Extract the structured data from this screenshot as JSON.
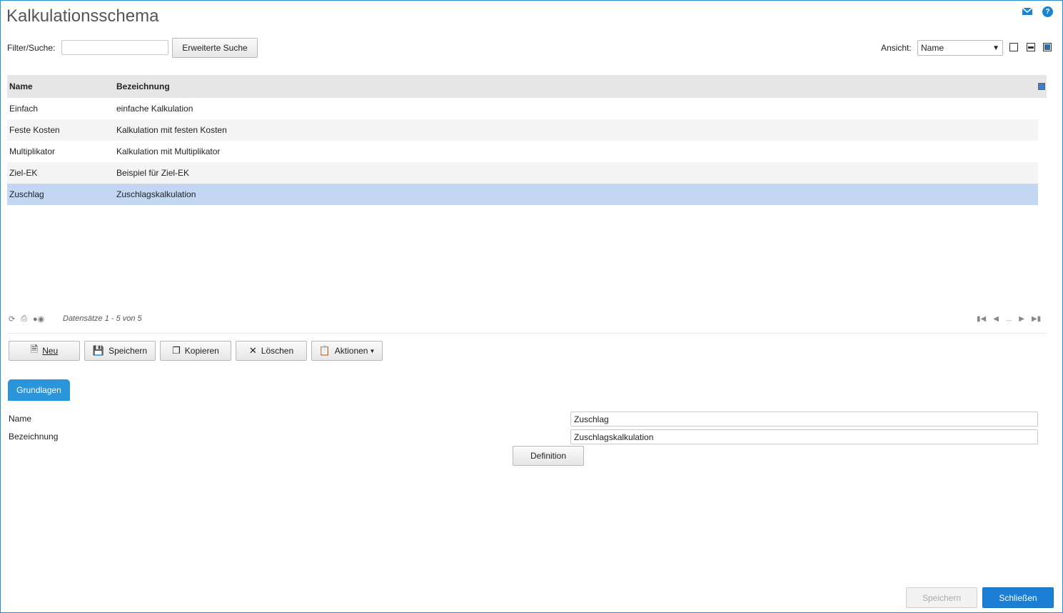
{
  "header": {
    "title": "Kalkulationsschema"
  },
  "filter": {
    "label": "Filter/Suche:",
    "value": "",
    "advanced_label": "Erweiterte Suche"
  },
  "view": {
    "label": "Ansicht:",
    "selected": "Name"
  },
  "grid": {
    "columns": [
      "Name",
      "Bezeichnung"
    ],
    "rows": [
      {
        "name": "Einfach",
        "bezeichnung": "einfache Kalkulation"
      },
      {
        "name": "Feste Kosten",
        "bezeichnung": "Kalkulation mit festen Kosten"
      },
      {
        "name": "Multiplikator",
        "bezeichnung": "Kalkulation mit Multiplikator"
      },
      {
        "name": "Ziel-EK",
        "bezeichnung": "Beispiel für Ziel-EK"
      },
      {
        "name": "Zuschlag",
        "bezeichnung": "Zuschlagskalkulation"
      }
    ],
    "records_text": "Datensätze 1 - 5 von 5",
    "pager_ellipsis": "..."
  },
  "actions": {
    "new": "Neu",
    "save": "Speichern",
    "copy": "Kopieren",
    "delete": "Löschen",
    "actions": "Aktionen"
  },
  "tabs": {
    "active": "Grundlagen"
  },
  "form": {
    "name_label": "Name",
    "name_value": "Zuschlag",
    "bez_label": "Bezeichnung",
    "bez_value": "Zuschlagskalkulation",
    "definition_label": "Definition"
  },
  "footer": {
    "save_label": "Speichern",
    "close_label": "Schließen"
  }
}
